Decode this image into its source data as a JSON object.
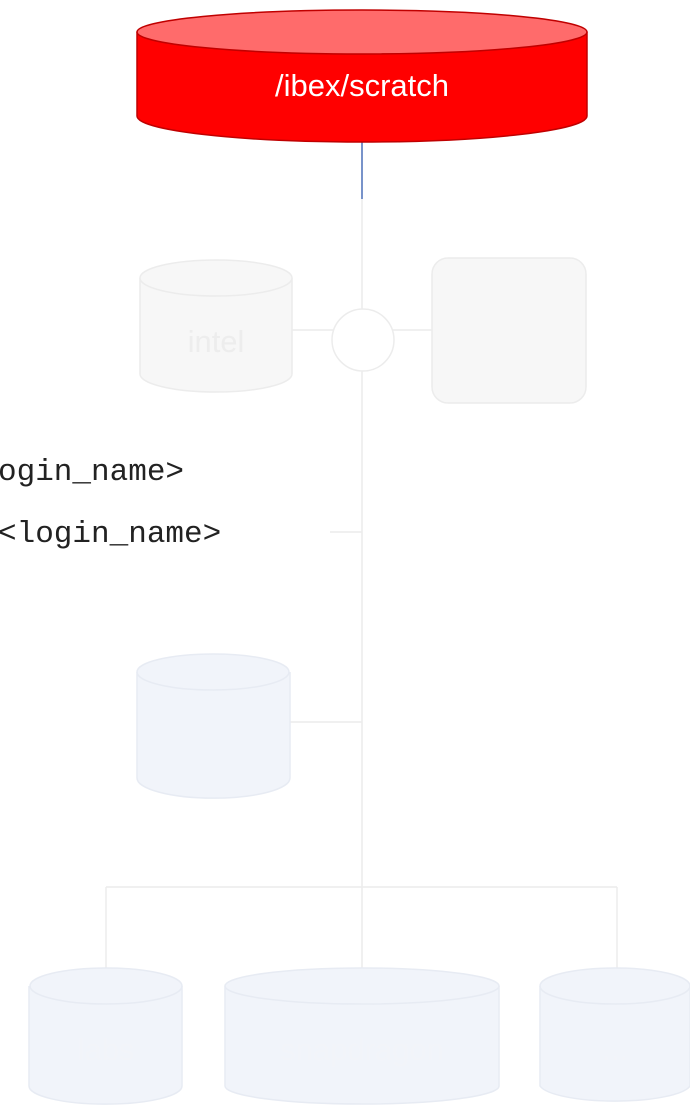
{
  "diagram": {
    "root_label": "/ibex/scratch",
    "path_lines": [
      "ogin_name>",
      "<login_name>"
    ],
    "nodes": {
      "intel": "intel",
      "labs": "labs",
      "snapdragon": "snapdragon",
      "more": "..."
    },
    "colors": {
      "root_fill": "#ff0000",
      "root_top": "#ff6b6b",
      "root_stroke": "#c00000",
      "faded_fill": "#f7f7f7",
      "faded_stroke": "#ececec",
      "faded_text": "#ededed",
      "blue_fill": "#f1f4fa",
      "blue_stroke": "#e7ebf3",
      "blue_text": "#f2f4f9",
      "connector": "#ececec",
      "root_connector": "#4a6fb8"
    }
  }
}
